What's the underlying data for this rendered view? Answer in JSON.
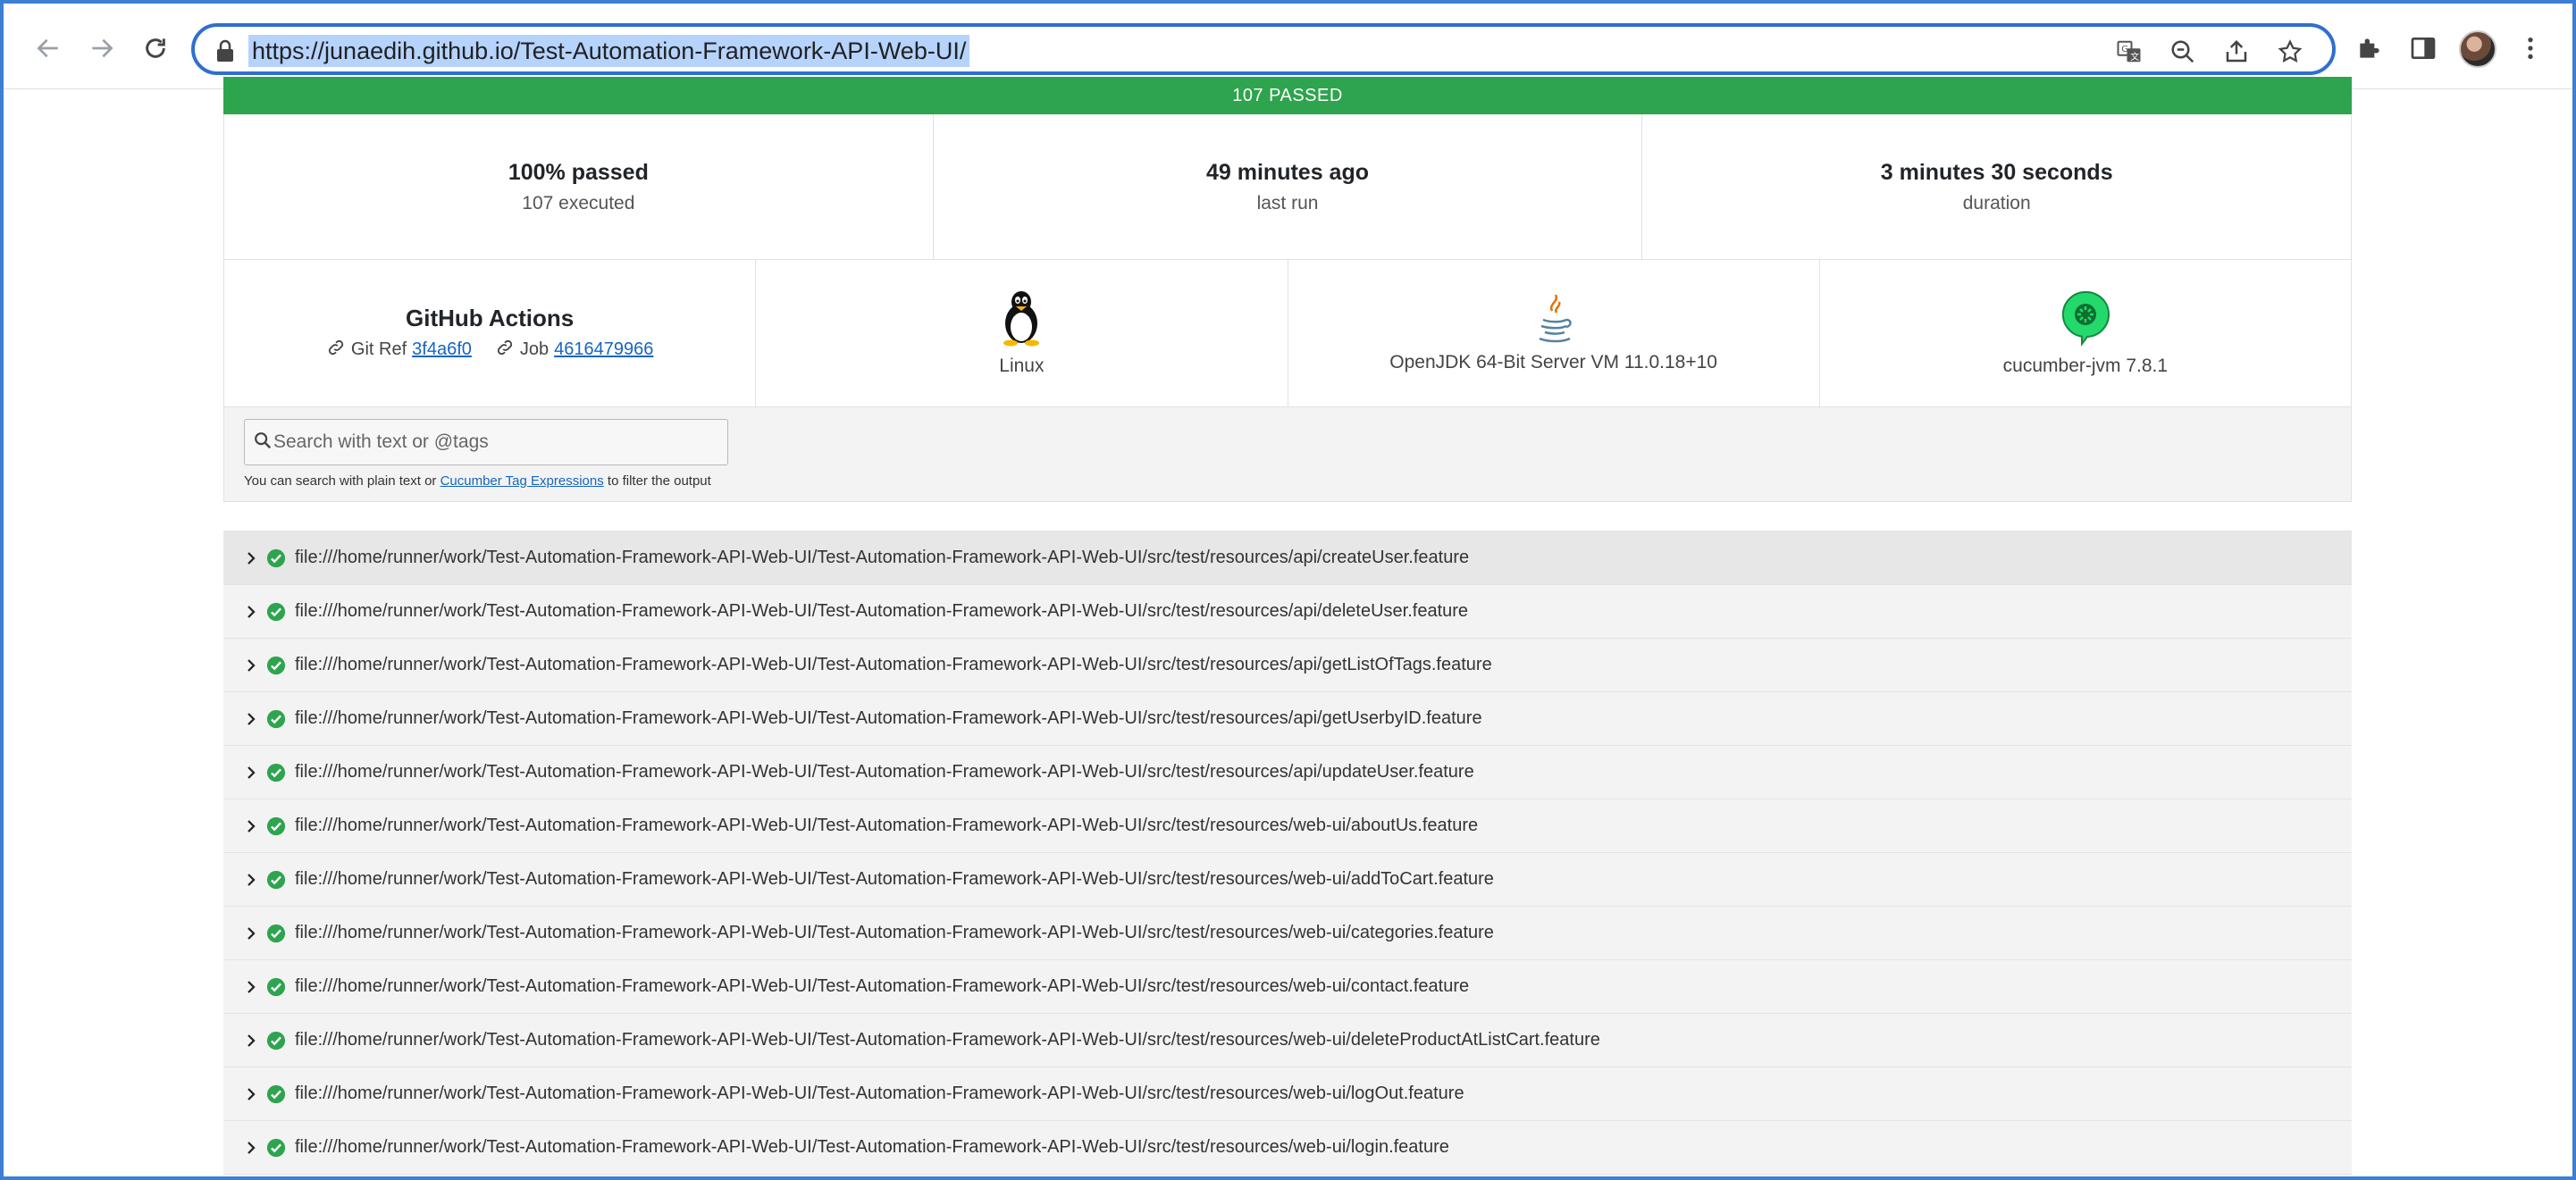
{
  "browser": {
    "url": "https://junaedih.github.io/Test-Automation-Framework-API-Web-UI/"
  },
  "report": {
    "banner": "107 PASSED",
    "stats": [
      {
        "value": "100% passed",
        "label": "107 executed"
      },
      {
        "value": "49 minutes ago",
        "label": "last run"
      },
      {
        "value": "3 minutes 30 seconds",
        "label": "duration"
      }
    ],
    "ci": {
      "title": "GitHub Actions",
      "git_ref_label": "Git Ref",
      "git_ref": "3f4a6f0",
      "job_label": "Job",
      "job": "4616479966"
    },
    "os": "Linux",
    "runtime": "OpenJDK 64-Bit Server VM 11.0.18+10",
    "implementation": "cucumber-jvm 7.8.1",
    "search": {
      "placeholder": "Search with text or @tags",
      "help_prefix": "You can search with plain text or",
      "help_link": "Cucumber Tag Expressions",
      "help_suffix": "to filter the output"
    },
    "features": [
      "file:///home/runner/work/Test-Automation-Framework-API-Web-UI/Test-Automation-Framework-API-Web-UI/src/test/resources/api/createUser.feature",
      "file:///home/runner/work/Test-Automation-Framework-API-Web-UI/Test-Automation-Framework-API-Web-UI/src/test/resources/api/deleteUser.feature",
      "file:///home/runner/work/Test-Automation-Framework-API-Web-UI/Test-Automation-Framework-API-Web-UI/src/test/resources/api/getListOfTags.feature",
      "file:///home/runner/work/Test-Automation-Framework-API-Web-UI/Test-Automation-Framework-API-Web-UI/src/test/resources/api/getUserbyID.feature",
      "file:///home/runner/work/Test-Automation-Framework-API-Web-UI/Test-Automation-Framework-API-Web-UI/src/test/resources/api/updateUser.feature",
      "file:///home/runner/work/Test-Automation-Framework-API-Web-UI/Test-Automation-Framework-API-Web-UI/src/test/resources/web-ui/aboutUs.feature",
      "file:///home/runner/work/Test-Automation-Framework-API-Web-UI/Test-Automation-Framework-API-Web-UI/src/test/resources/web-ui/addToCart.feature",
      "file:///home/runner/work/Test-Automation-Framework-API-Web-UI/Test-Automation-Framework-API-Web-UI/src/test/resources/web-ui/categories.feature",
      "file:///home/runner/work/Test-Automation-Framework-API-Web-UI/Test-Automation-Framework-API-Web-UI/src/test/resources/web-ui/contact.feature",
      "file:///home/runner/work/Test-Automation-Framework-API-Web-UI/Test-Automation-Framework-API-Web-UI/src/test/resources/web-ui/deleteProductAtListCart.feature",
      "file:///home/runner/work/Test-Automation-Framework-API-Web-UI/Test-Automation-Framework-API-Web-UI/src/test/resources/web-ui/logOut.feature",
      "file:///home/runner/work/Test-Automation-Framework-API-Web-UI/Test-Automation-Framework-API-Web-UI/src/test/resources/web-ui/login.feature"
    ]
  },
  "colors": {
    "passed_green": "#2ea44f",
    "link_blue": "#1565c0",
    "focus_blue": "#2f6fd0"
  }
}
